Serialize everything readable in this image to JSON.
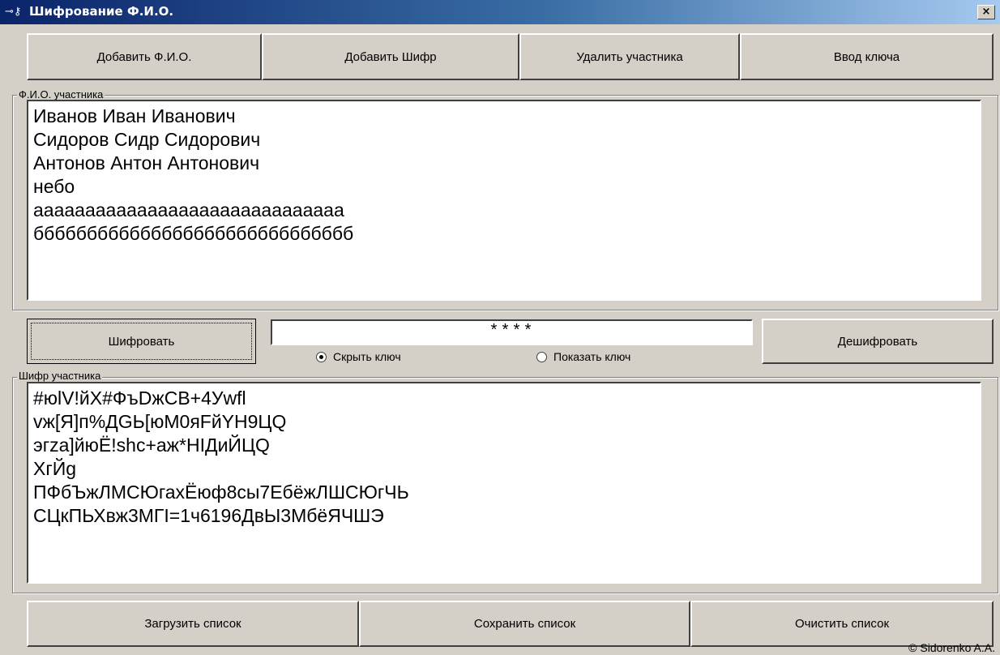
{
  "window": {
    "title": "Шифрование Ф.И.О.",
    "close_label": "×"
  },
  "toolbar": {
    "add_name": "Добавить Ф.И.О.",
    "add_cipher": "Добавить Шифр",
    "delete_participant": "Удалить участника",
    "enter_key": "Ввод ключа"
  },
  "names_group": {
    "label": "Ф.И.О. участника",
    "lines": [
      "Иванов Иван Иванович",
      "Сидоров Сидр Сидорович",
      "Антонов Антон Антонович",
      "небо",
      "аааааааааааааааааааааааааааааа",
      "бббббббббббббббббббббббббббббб"
    ]
  },
  "key_panel": {
    "encrypt": "Шифровать",
    "decrypt": "Дешифровать",
    "key_value": "****",
    "hide_key": "Скрыть ключ",
    "show_key": "Показать ключ",
    "selected": "hide_key"
  },
  "cipher_group": {
    "label": "Шифр участника",
    "lines": [
      "#юlV!йX#ФъDжCB+4Уwfl",
      "vж[Я]п%ДGЬ[юM0яFйYH9ЦQ",
      "эгza]йюЁ!shc+аж*НIДиЙЦQ",
      "ХгЙg",
      "ПФбЪжЛМСЮгахЁюф8сы7ЕбёжЛШСЮгЧЬ",
      "СЦкПЬХвж3МГI=1ч6196ДвЫ3МбёЯЧШЭ"
    ]
  },
  "bottom": {
    "load": "Загрузить список",
    "save": "Сохранить список",
    "clear": "Очистить список",
    "copyright": "© Sidorenko A.A."
  }
}
